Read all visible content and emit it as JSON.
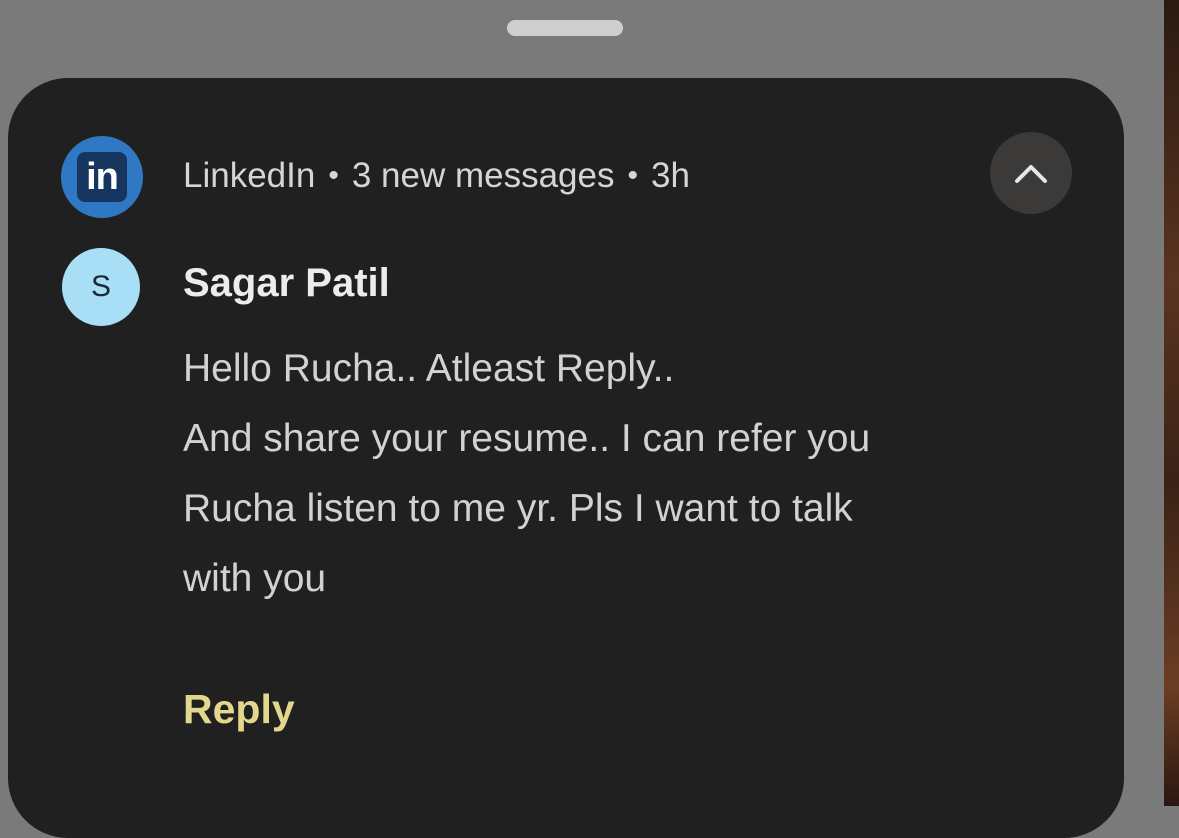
{
  "notification": {
    "app_icon": "linkedin-icon",
    "app_icon_text": "in",
    "app_name": "LinkedIn",
    "separator": "•",
    "summary": "3 new messages",
    "time": "3h",
    "collapse_icon": "chevron-up-icon"
  },
  "message": {
    "avatar_initial": "S",
    "sender": "Sagar Patil",
    "lines": [
      "Hello Rucha.. Atleast Reply..",
      "And share your resume.. I can refer you",
      "Rucha listen to me yr. Pls I want to talk",
      "with you"
    ]
  },
  "actions": {
    "reply_label": "Reply"
  },
  "colors": {
    "card_background": "#202020",
    "screen_background": "#7a7a7a",
    "linkedin_blue": "#2f79c4",
    "avatar_background": "#a9dff6",
    "reply_accent": "#e3d78e"
  }
}
